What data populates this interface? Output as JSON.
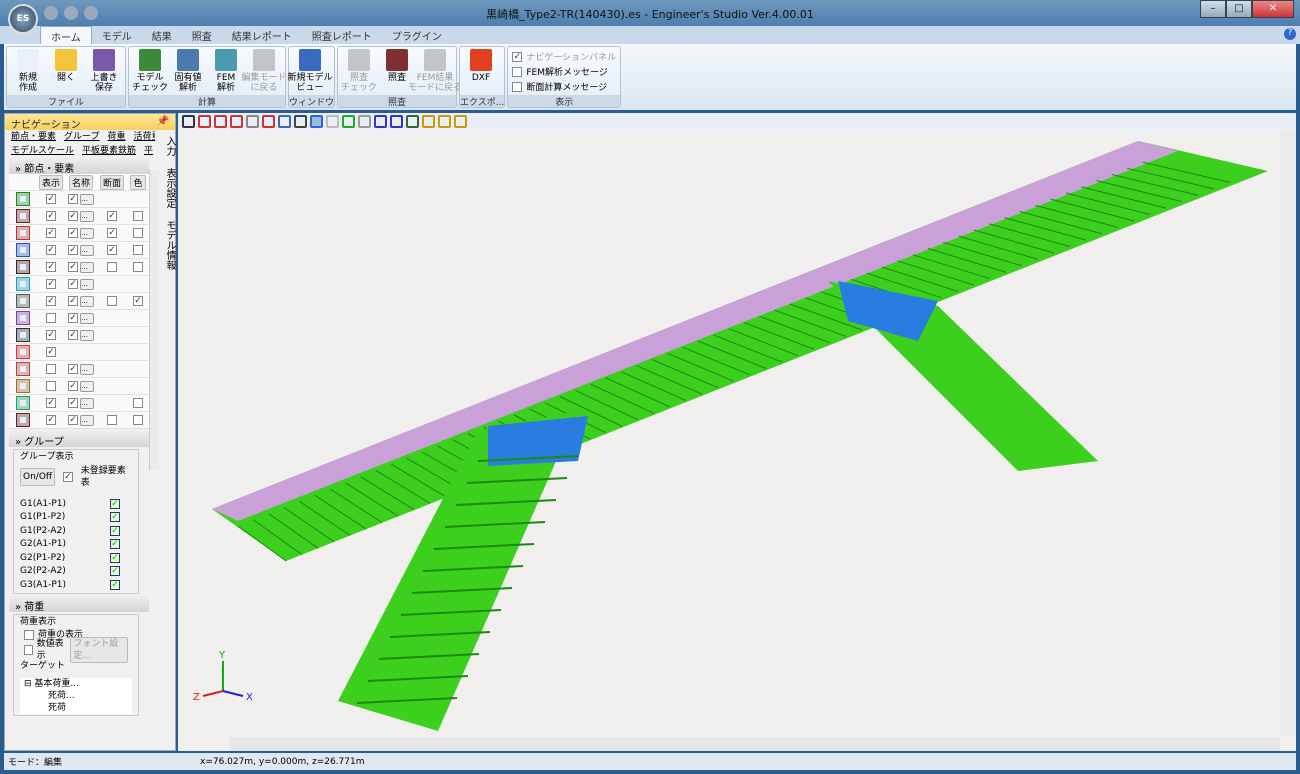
{
  "window": {
    "title": "黒崎橋_Type2-TR(140430).es - Engineer's Studio Ver.4.00.01",
    "app_logo": "ES",
    "controls": [
      "–",
      "□",
      "✕"
    ]
  },
  "tabs": [
    "ホーム",
    "モデル",
    "結果",
    "照査",
    "結果レポート",
    "照査レポート",
    "プラグイン"
  ],
  "help": "?",
  "ribbon": {
    "groups": [
      {
        "label": "ファイル",
        "buttons": [
          {
            "label": "新規\n作成",
            "icon": "new-file-icon",
            "color": "#e8f0fa",
            "disabled": false
          },
          {
            "label": "開く",
            "icon": "open-folder-icon",
            "color": "#f3c33a",
            "disabled": false
          },
          {
            "label": "上書き\n保存",
            "icon": "save-icon",
            "color": "#7a5aa8",
            "disabled": false
          }
        ]
      },
      {
        "label": "計算",
        "buttons": [
          {
            "label": "モデル\nチェック",
            "icon": "model-check-icon",
            "color": "#3a8a3a",
            "disabled": false
          },
          {
            "label": "固有値\n解析",
            "icon": "eigen-analysis-icon",
            "color": "#4a7ab0",
            "disabled": false
          },
          {
            "label": "FEM\n解析",
            "icon": "fem-analysis-icon",
            "color": "#4a9ab0",
            "disabled": false
          },
          {
            "label": "編集モード\nに戻る",
            "icon": "edit-mode-icon",
            "color": "#888888",
            "disabled": true
          }
        ]
      },
      {
        "label": "ウィンドウ",
        "buttons": [
          {
            "label": "新規モデル\nビュー",
            "icon": "new-view-icon",
            "color": "#3a6ac0",
            "disabled": false
          }
        ]
      },
      {
        "label": "照査",
        "buttons": [
          {
            "label": "照査\nチェック",
            "icon": "check-verify-icon",
            "color": "#888888",
            "disabled": true
          },
          {
            "label": "照査",
            "icon": "verify-icon",
            "color": "#803030",
            "disabled": false
          },
          {
            "label": "FEM結果\nモードに戻る",
            "icon": "fem-result-mode-icon",
            "color": "#888888",
            "disabled": true
          }
        ]
      },
      {
        "label": "エクスポ...",
        "buttons": [
          {
            "label": "DXF",
            "icon": "dxf-export-icon",
            "color": "#e04020",
            "disabled": false
          }
        ]
      }
    ],
    "display": {
      "label": "表示",
      "checks": [
        {
          "label": "ナビゲーションパネル",
          "checked": true
        },
        {
          "label": "FEM解析メッセージ",
          "checked": false
        },
        {
          "label": "断面計算メッセージ",
          "checked": false
        }
      ]
    }
  },
  "nav": {
    "title": "ナビゲーション",
    "pin": "📌",
    "links1": [
      "節点・要素",
      "グループ",
      "荷重",
      "活荷重"
    ],
    "links2": [
      "モデルスケール",
      "平板要素鉄筋",
      "平"
    ],
    "side_tabs": [
      "入力",
      "表示設定",
      "モデル情報"
    ],
    "nodes_section": "節点・要素",
    "grid_headers": [
      "表示",
      "名称",
      "断面",
      "色"
    ],
    "rows": [
      {
        "icon": "node-icon",
        "c": "#1a8a1a",
        "show": true,
        "name": true,
        "sec": null,
        "color": null
      },
      {
        "icon": "beam-element-icon",
        "c": "#702020",
        "show": true,
        "name": true,
        "sec": true,
        "color": false
      },
      {
        "icon": "fiber-element-icon",
        "c": "#c03030",
        "show": true,
        "name": true,
        "sec": true,
        "color": false
      },
      {
        "icon": "spring-element-icon",
        "c": "#3050c0",
        "show": true,
        "name": true,
        "sec": true,
        "color": false
      },
      {
        "icon": "rigid-element-icon",
        "c": "#402020",
        "show": true,
        "name": true,
        "sec": false,
        "color": false
      },
      {
        "icon": "plate-element-icon",
        "c": "#20a0c0",
        "show": true,
        "name": true,
        "sec": null,
        "color": null
      },
      {
        "icon": "solid-element-icon",
        "c": "#555555",
        "show": true,
        "name": true,
        "sec": false,
        "color": true
      },
      {
        "icon": "cable-icon",
        "c": "#8040a0",
        "show": false,
        "name": true,
        "sec": null,
        "color": null
      },
      {
        "icon": "support-icon",
        "c": "#303030",
        "show": true,
        "name": true,
        "sec": null,
        "color": null
      },
      {
        "icon": "mesh-icon",
        "c": "#e03030",
        "show": true,
        "name": null,
        "sec": null,
        "color": null
      },
      {
        "icon": "local-axis-icon",
        "c": "#c04040",
        "show": false,
        "name": true,
        "sec": null,
        "color": null
      },
      {
        "icon": "hinge-icon",
        "c": "#a07020",
        "show": false,
        "name": true,
        "sec": null,
        "color": null
      },
      {
        "icon": "curve-icon",
        "c": "#20a060",
        "show": true,
        "name": true,
        "sec": null,
        "color": false
      },
      {
        "icon": "link-icon",
        "c": "#602020",
        "show": true,
        "name": true,
        "sec": false,
        "color": false
      }
    ],
    "group_section": "グループ",
    "group_display": "グループ表示",
    "onoff": "On/Off",
    "unregistered": "未登録要素表",
    "groups": [
      "G1(A1-P1)",
      "G1(P1-P2)",
      "G1(P2-A2)",
      "G2(A1-P1)",
      "G2(P1-P2)",
      "G2(P2-A2)",
      "G3(A1-P1)"
    ],
    "load_section": "荷重",
    "load_display": "荷重表示",
    "show_load": "荷重の表示",
    "show_value": "数値表示",
    "font_btn": "フォント設定...",
    "target": "ターゲット",
    "tree": [
      "基本荷重...",
      "死荷...",
      "死荷"
    ],
    "tree_toggle": "⊟"
  },
  "axes": {
    "y": "Y",
    "z": "Z",
    "x": "X"
  },
  "status": {
    "mode": "モード：編集",
    "coords": "x=76.027m, y=0.000m, z=26.771m"
  },
  "colors": {
    "green": "#3ccf1e",
    "blue": "#2a7de0",
    "pink": "#c9a0d8"
  }
}
